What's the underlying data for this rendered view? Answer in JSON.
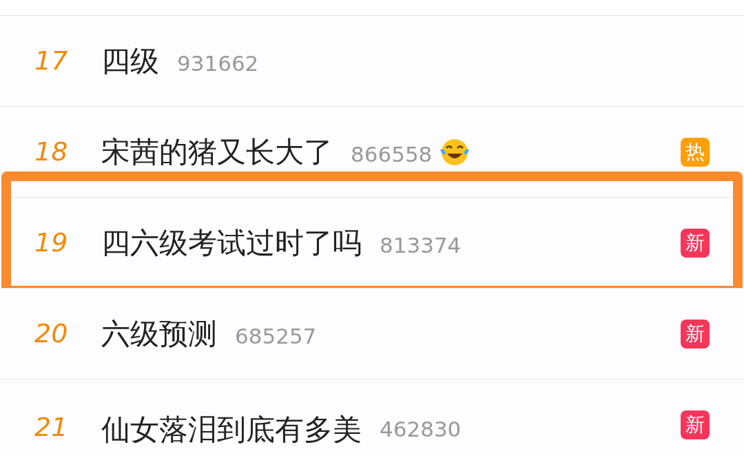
{
  "hot_search_list": [
    {
      "rank": "17",
      "title": "四级",
      "count": "931662",
      "emoji": false,
      "highlighted": false
    },
    {
      "rank": "18",
      "title": "宋茜的猪又长大了",
      "count": "866558",
      "emoji": true,
      "badge": {
        "kind": "hot",
        "text": "热"
      },
      "highlighted": false
    },
    {
      "rank": "19",
      "title": "四六级考试过时了吗",
      "count": "813374",
      "emoji": false,
      "badge": {
        "kind": "new",
        "text": "新"
      },
      "highlighted": true
    },
    {
      "rank": "20",
      "title": "六级预测",
      "count": "685257",
      "emoji": false,
      "badge": {
        "kind": "new",
        "text": "新"
      },
      "highlighted": false
    },
    {
      "rank": "21",
      "title": "仙女落泪到底有多美",
      "count": "462830",
      "emoji": false,
      "badge": {
        "kind": "new",
        "text": "新"
      },
      "highlighted": false
    }
  ]
}
